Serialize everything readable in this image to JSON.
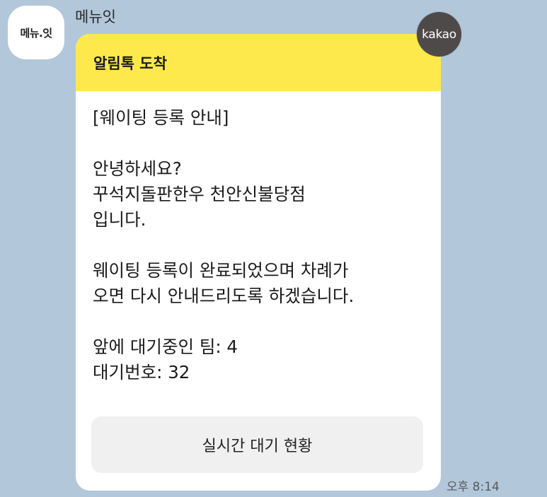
{
  "sender": {
    "avatar_text": "메뉴.잇",
    "name": "메뉴잇"
  },
  "message": {
    "header_title": "알림톡 도착",
    "lines": [
      "[웨이팅 등록 안내]",
      "",
      "안녕하세요?",
      "꾸석지돌판한우 천안신불당점",
      "입니다.",
      "",
      "웨이팅 등록이 완료되었으며 차례가",
      "오면 다시 안내드리도록 하겠습니다.",
      "",
      "앞에 대기중인 팀: 4",
      "대기번호: 32"
    ],
    "button_label": "실시간 대기 현황"
  },
  "badge": {
    "text": "kakao"
  },
  "timestamp": "오후 8:14",
  "colors": {
    "background": "#b2c7d9",
    "header": "#fee94c",
    "button_bg": "#f0f0f0",
    "badge_bg": "#4f4a4a"
  }
}
